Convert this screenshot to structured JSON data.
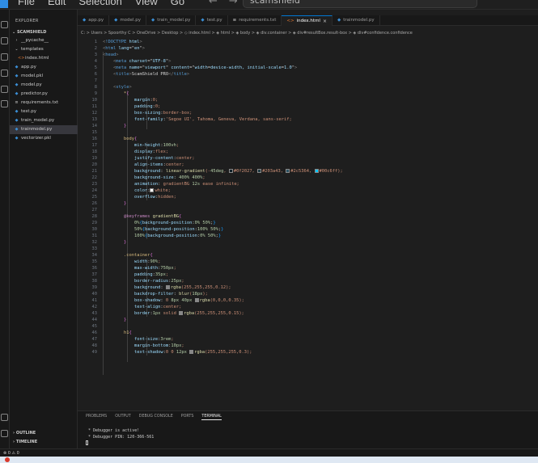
{
  "titlebar": {
    "menu": [
      "File",
      "Edit",
      "Selection",
      "View",
      "Go"
    ],
    "more": "···",
    "back_arrow": "←",
    "forward_arrow": "→",
    "search_text": "scamshield"
  },
  "sidebar": {
    "header": "EXPLORER",
    "project": "SCAMSHIELD",
    "items": [
      {
        "label": "__pycache__",
        "chevron": ">",
        "icon": "folder",
        "indent": 1
      },
      {
        "label": "templates",
        "chevron": "v",
        "icon": "folder",
        "indent": 1
      },
      {
        "label": "index.html",
        "chevron": "",
        "icon": "html",
        "indent": 2
      },
      {
        "label": "app.py",
        "chevron": "",
        "icon": "py",
        "indent": 1
      },
      {
        "label": "model.pkl",
        "chevron": "",
        "icon": "pkl",
        "indent": 1
      },
      {
        "label": "model.py",
        "chevron": "",
        "icon": "py",
        "indent": 1
      },
      {
        "label": "predictor.py",
        "chevron": "",
        "icon": "py",
        "indent": 1
      },
      {
        "label": "requirements.txt",
        "chevron": "",
        "icon": "txt",
        "indent": 1
      },
      {
        "label": "test.py",
        "chevron": "",
        "icon": "py",
        "indent": 1
      },
      {
        "label": "train_model.py",
        "chevron": "",
        "icon": "py",
        "indent": 1
      },
      {
        "label": "trainmodel.py",
        "chevron": "",
        "icon": "py",
        "indent": 1,
        "selected": true
      },
      {
        "label": "vectorizer.pkl",
        "chevron": "",
        "icon": "pkl",
        "indent": 1
      }
    ],
    "outline": "OUTLINE",
    "timeline": "TIMELINE"
  },
  "tabs": [
    {
      "label": "app.py",
      "icon": "py"
    },
    {
      "label": "model.py",
      "icon": "py"
    },
    {
      "label": "train_model.py",
      "icon": "py"
    },
    {
      "label": "test.py",
      "icon": "py"
    },
    {
      "label": "requirements.txt",
      "icon": "txt"
    },
    {
      "label": "index.html",
      "icon": "html",
      "active": true,
      "close": "×"
    },
    {
      "label": "trainmodel.py",
      "icon": "py"
    }
  ],
  "breadcrumb": "C: > Users > Spoorthy C > OneDrive > Desktop > ◇ index.html > ◈ html > ◈ body > ◈ div.container > ◈ div#resultBox.result-box > ◈ div#confidence.confidence",
  "code_lines": [
    {
      "n": 1,
      "text": "<!DOCTYPE html>"
    },
    {
      "n": 2,
      "text": "<html lang=\"en\">"
    },
    {
      "n": 3,
      "text": "<head>"
    },
    {
      "n": 4,
      "text": "    <meta charset=\"UTF-8\">"
    },
    {
      "n": 5,
      "text": "    <meta name=\"viewport\" content=\"width=device-width, initial-scale=1.0\">"
    },
    {
      "n": 6,
      "text": "    <title>ScamShield PRO</title>"
    },
    {
      "n": 7,
      "text": ""
    },
    {
      "n": 8,
      "text": "    <style>"
    },
    {
      "n": 9,
      "text": "        *{"
    },
    {
      "n": 10,
      "text": "            margin:0;"
    },
    {
      "n": 11,
      "text": "            padding:0;"
    },
    {
      "n": 12,
      "text": "            box-sizing:border-box;"
    },
    {
      "n": 13,
      "text": "            font-family:'Segoe UI', Tahoma, Geneva, Verdana, sans-serif;"
    },
    {
      "n": 14,
      "text": "        }"
    },
    {
      "n": 15,
      "text": ""
    },
    {
      "n": 16,
      "text": "        body{"
    },
    {
      "n": 17,
      "text": "            min-height:100vh;"
    },
    {
      "n": 18,
      "text": "            display:flex;"
    },
    {
      "n": 19,
      "text": "            justify-content:center;"
    },
    {
      "n": 20,
      "text": "            align-items:center;"
    },
    {
      "n": 21,
      "text": "            background: linear-gradient(-45deg, #0f2027, #203a43, #2c5364, #00c6ff);"
    },
    {
      "n": 22,
      "text": "            background-size: 400% 400%;"
    },
    {
      "n": 23,
      "text": "            animation: gradientBG 12s ease infinite;"
    },
    {
      "n": 24,
      "text": "            color:white;"
    },
    {
      "n": 25,
      "text": "            overflow:hidden;"
    },
    {
      "n": 26,
      "text": "        }"
    },
    {
      "n": 27,
      "text": ""
    },
    {
      "n": 28,
      "text": "        @keyframes gradientBG{"
    },
    {
      "n": 29,
      "text": "            0%{background-position:0% 50%;}"
    },
    {
      "n": 30,
      "text": "            50%{background-position:100% 50%;}"
    },
    {
      "n": 31,
      "text": "            100%{background-position:0% 50%;}"
    },
    {
      "n": 32,
      "text": "        }"
    },
    {
      "n": 33,
      "text": ""
    },
    {
      "n": 34,
      "text": "        .container{"
    },
    {
      "n": 35,
      "text": "            width:90%;"
    },
    {
      "n": 36,
      "text": "            max-width:750px;"
    },
    {
      "n": 37,
      "text": "            padding:35px;"
    },
    {
      "n": 38,
      "text": "            border-radius:25px;"
    },
    {
      "n": 39,
      "text": "            background: rgba(255,255,255,0.12);"
    },
    {
      "n": 40,
      "text": "            backdrop-filter: blur(18px);"
    },
    {
      "n": 41,
      "text": "            box-shadow: 0 8px 40px rgba(0,0,0,0.35);"
    },
    {
      "n": 42,
      "text": "            text-align:center;"
    },
    {
      "n": 43,
      "text": "            border:1px solid rgba(255,255,255,0.15);"
    },
    {
      "n": 44,
      "text": "        }"
    },
    {
      "n": 45,
      "text": ""
    },
    {
      "n": 46,
      "text": "        h1{"
    },
    {
      "n": 47,
      "text": "            font-size:3rem;"
    },
    {
      "n": 48,
      "text": "            margin-bottom:10px;"
    },
    {
      "n": 49,
      "text": "            text-shadow:0 0 12px rgba(255,255,255,0.3);"
    }
  ],
  "swatch_colors": {
    "#0f2027": "#0f2027",
    "#203a43": "#203a43",
    "#2c5364": "#2c5364",
    "#00c6ff": "#00c6ff",
    "white": "#ffffff"
  },
  "panel": {
    "tabs": [
      "PROBLEMS",
      "OUTPUT",
      "DEBUG CONSOLE",
      "PORTS",
      "TERMINAL"
    ],
    "active_tab": "TERMINAL",
    "terminal_lines": [
      " * Debugger is active!",
      " * Debugger PIN: 120-366-561"
    ]
  },
  "statusbar": {
    "text": "⊗ 0 ⚠ 0"
  }
}
